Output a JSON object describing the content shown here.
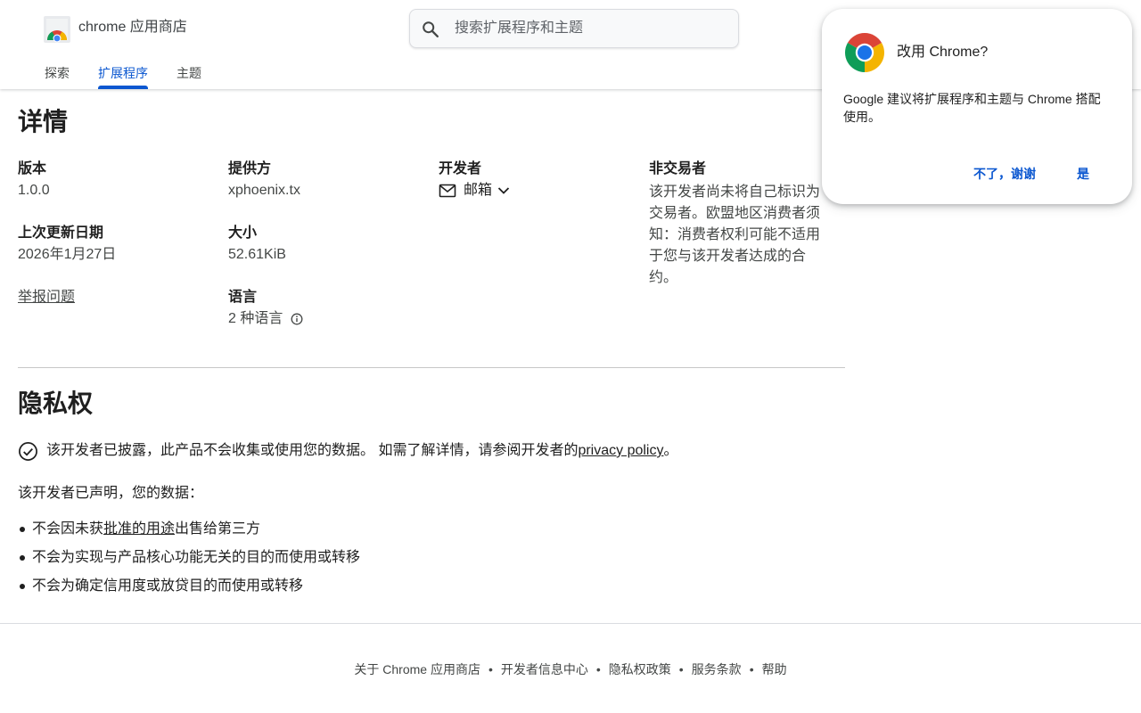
{
  "header": {
    "brand": "chrome 应用商店",
    "search_placeholder": "搜索扩展程序和主题",
    "tabs": [
      {
        "label": "探索",
        "active": false
      },
      {
        "label": "扩展程序",
        "active": true
      },
      {
        "label": "主题",
        "active": false
      }
    ]
  },
  "details": {
    "title": "详情",
    "version_label": "版本",
    "version_value": "1.0.0",
    "provider_label": "提供方",
    "provider_value": "xphoenix.tx",
    "developer_label": "开发者",
    "developer_email": "邮箱",
    "trader_label": "非交易者",
    "trader_text": "该开发者尚未将自己标识为交易者。欧盟地区消费者须知：消费者权利可能不适用于您与该开发者达成的合约。",
    "updated_label": "上次更新日期",
    "updated_value": "2026年1月27日",
    "size_label": "大小",
    "size_value": "52.61KiB",
    "report_link": "举报问题",
    "language_label": "语言",
    "language_value": "2 种语言"
  },
  "privacy": {
    "title": "隐私权",
    "disclosure_text": "该开发者已披露，此产品不会收集或使用您的数据。 如需了解详情，请参阅开发者的",
    "policy_link": "privacy policy",
    "disclosure_end": "。",
    "declared_heading": "该开发者已声明，您的数据：",
    "bullet1_pre": "不会因未获",
    "bullet1_link": "批准的用途",
    "bullet1_post": "出售给第三方",
    "bullet2": "不会为实现与产品核心功能无关的目的而使用或转移",
    "bullet3": "不会为确定信用度或放贷目的而使用或转移"
  },
  "footer": {
    "links": [
      "关于 Chrome 应用商店",
      "开发者信息中心",
      "隐私权政策",
      "服务条款",
      "帮助"
    ],
    "separator": "•"
  },
  "dialog": {
    "title": "改用 Chrome?",
    "body": "Google 建议将扩展程序和主题与 Chrome 搭配使用。",
    "decline_button": "不了，谢谢",
    "accept_button": "是"
  },
  "colors": {
    "accent": "#0b57d0",
    "text_primary": "#1f1f1f",
    "text_secondary": "#444746",
    "divider": "#c7c7c7"
  }
}
